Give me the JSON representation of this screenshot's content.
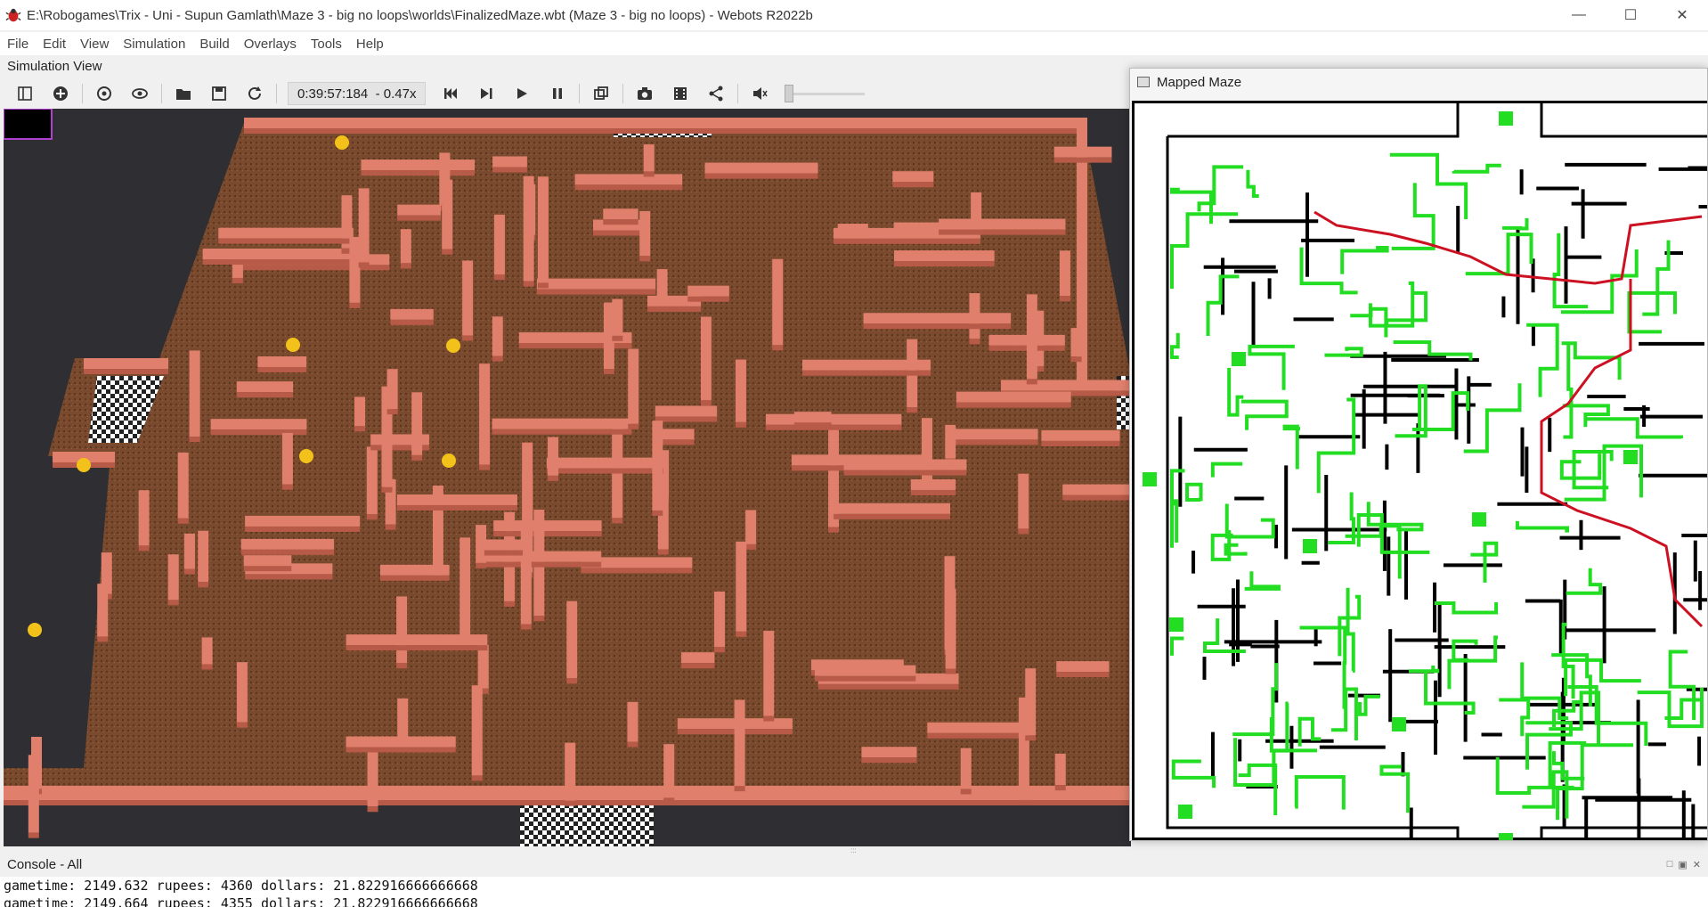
{
  "window": {
    "title": "E:\\Robogames\\Trix - Uni - Supun Gamlath\\Maze 3 - big no loops\\worlds\\FinalizedMaze.wbt (Maze 3 - big no loops) - Webots R2022b",
    "icon": "webots-bug-icon",
    "controls": [
      "minimize-icon",
      "maximize-icon",
      "close-icon"
    ]
  },
  "menu": [
    "File",
    "Edit",
    "View",
    "Simulation",
    "Build",
    "Overlays",
    "Tools",
    "Help"
  ],
  "simulation_view": {
    "label": "Simulation View",
    "time": "0:39:57:184",
    "speed": "- 0.47x",
    "toolbar_icons": [
      "scene-tree-icon",
      "add-node-icon",
      "reset-view-icon",
      "view-options-icon",
      "open-world-icon",
      "save-world-icon",
      "reload-world-icon",
      "step-back-icon",
      "step-icon",
      "run-icon",
      "pause-icon",
      "view-3d-icon",
      "screenshot-icon",
      "record-movie-icon",
      "share-icon",
      "sound-icon"
    ],
    "volume_level": 0.0
  },
  "mapped_maze": {
    "title": "Mapped Maze",
    "colors": {
      "green": "#22dd22",
      "red": "#cc1122",
      "black": "#000000"
    }
  },
  "console": {
    "label": "Console - All",
    "lines": [
      "gametime: 2149.632 rupees: 4360 dollars: 21.822916666666668",
      "gametime: 2149.664 rupees: 4355 dollars: 21.822916666666668"
    ]
  },
  "colors": {
    "wall": "#e0806c",
    "floor": "#7a4a2e",
    "background": "#2f2f33"
  }
}
